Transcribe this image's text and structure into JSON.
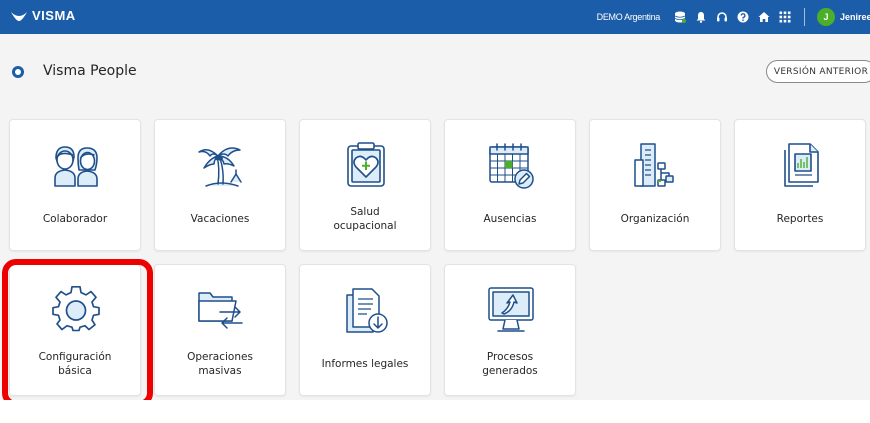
{
  "topbar": {
    "brand": "VISMA",
    "organization": "DEMO Argentina",
    "icons": [
      "database-icon",
      "bell-icon",
      "headset-icon",
      "help-icon",
      "home-icon",
      "app-grid-icon"
    ],
    "user": {
      "initial": "J",
      "name": "Jeniree"
    }
  },
  "app": {
    "title": "Visma People",
    "legacy_button": "VERSIÓN ANTERIOR"
  },
  "tiles": [
    {
      "label": [
        "Colaborador"
      ],
      "icon": "people-icon"
    },
    {
      "label": [
        "Vacaciones"
      ],
      "icon": "palm-tree-icon"
    },
    {
      "label": [
        "Salud",
        "ocupacional"
      ],
      "icon": "health-clipboard-icon"
    },
    {
      "label": [
        "Ausencias"
      ],
      "icon": "calendar-edit-icon"
    },
    {
      "label": [
        "Organización"
      ],
      "icon": "org-building-icon"
    },
    {
      "label": [
        "Reportes"
      ],
      "icon": "report-icon"
    },
    {
      "label": [
        "Configuración",
        "básica"
      ],
      "icon": "gear-icon"
    },
    {
      "label": [
        "Operaciones",
        "masivas"
      ],
      "icon": "folder-sync-icon"
    },
    {
      "label": [
        "Informes legales"
      ],
      "icon": "legal-docs-icon"
    },
    {
      "label": [
        "Procesos",
        "generados"
      ],
      "icon": "monitor-process-icon"
    }
  ],
  "colors": {
    "topbar": "#1b5da8",
    "icon_stroke": "#1f4f8a",
    "icon_fill": "#dcecf8",
    "accent_green": "#4caf29",
    "highlight": "#ee0000"
  }
}
